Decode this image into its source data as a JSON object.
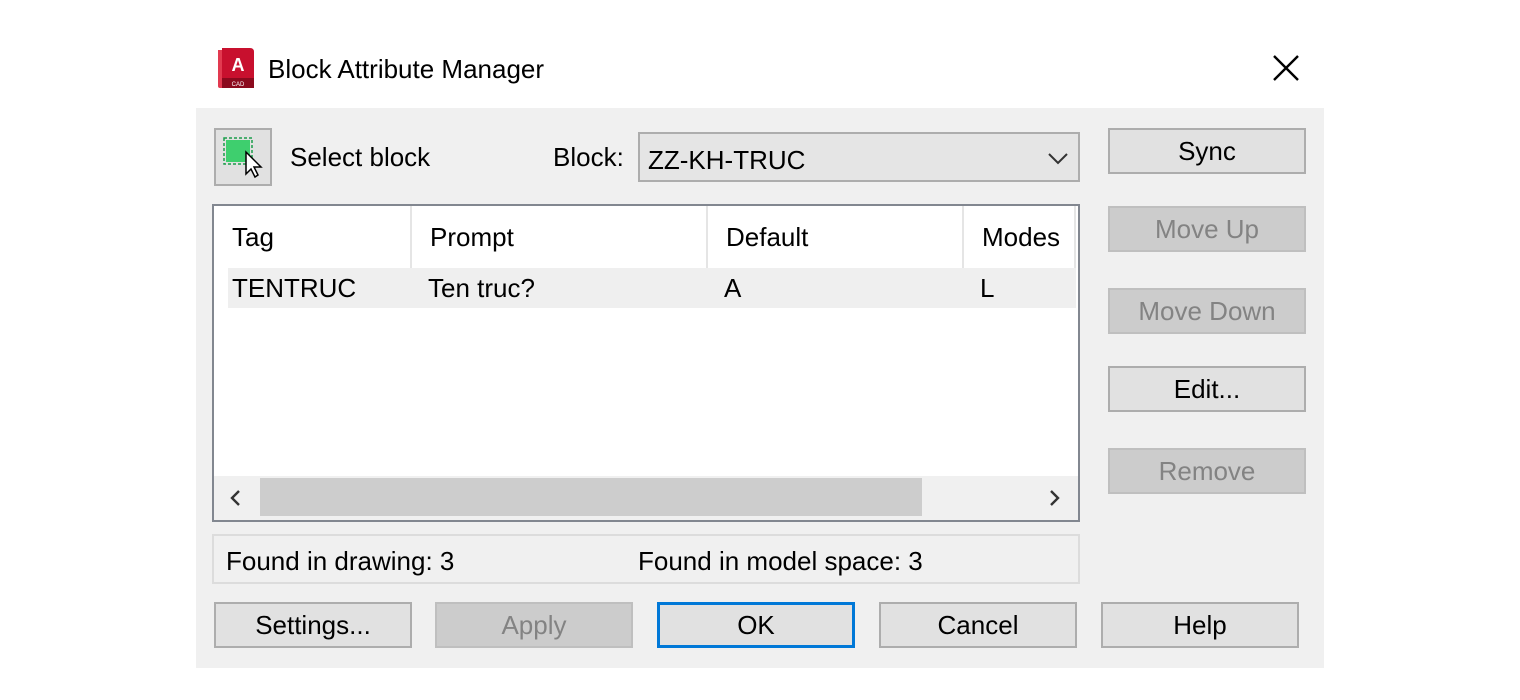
{
  "window": {
    "title": "Block Attribute Manager",
    "app_icon": "autocad-icon",
    "close_icon": "close-icon"
  },
  "toolbar": {
    "select_block_icon": "select-objects-icon",
    "select_block_label": "Select block",
    "block_label": "Block:",
    "block_value": "ZZ-KH-TRUC"
  },
  "table": {
    "columns": [
      "Tag",
      "Prompt",
      "Default",
      "Modes"
    ],
    "rows": [
      [
        "TENTRUC",
        "Ten truc?",
        "A",
        "L"
      ]
    ]
  },
  "status": {
    "found_in_drawing": "Found in drawing: 3",
    "found_in_model_space": "Found in model space: 3"
  },
  "side_buttons": {
    "sync": "Sync",
    "move_up": "Move Up",
    "move_down": "Move Down",
    "edit": "Edit...",
    "remove": "Remove"
  },
  "bottom_buttons": {
    "settings": "Settings...",
    "apply": "Apply",
    "ok": "OK",
    "cancel": "Cancel",
    "help": "Help"
  },
  "colors": {
    "accent": "#0078d7",
    "app_icon_red": "#c8102e"
  }
}
